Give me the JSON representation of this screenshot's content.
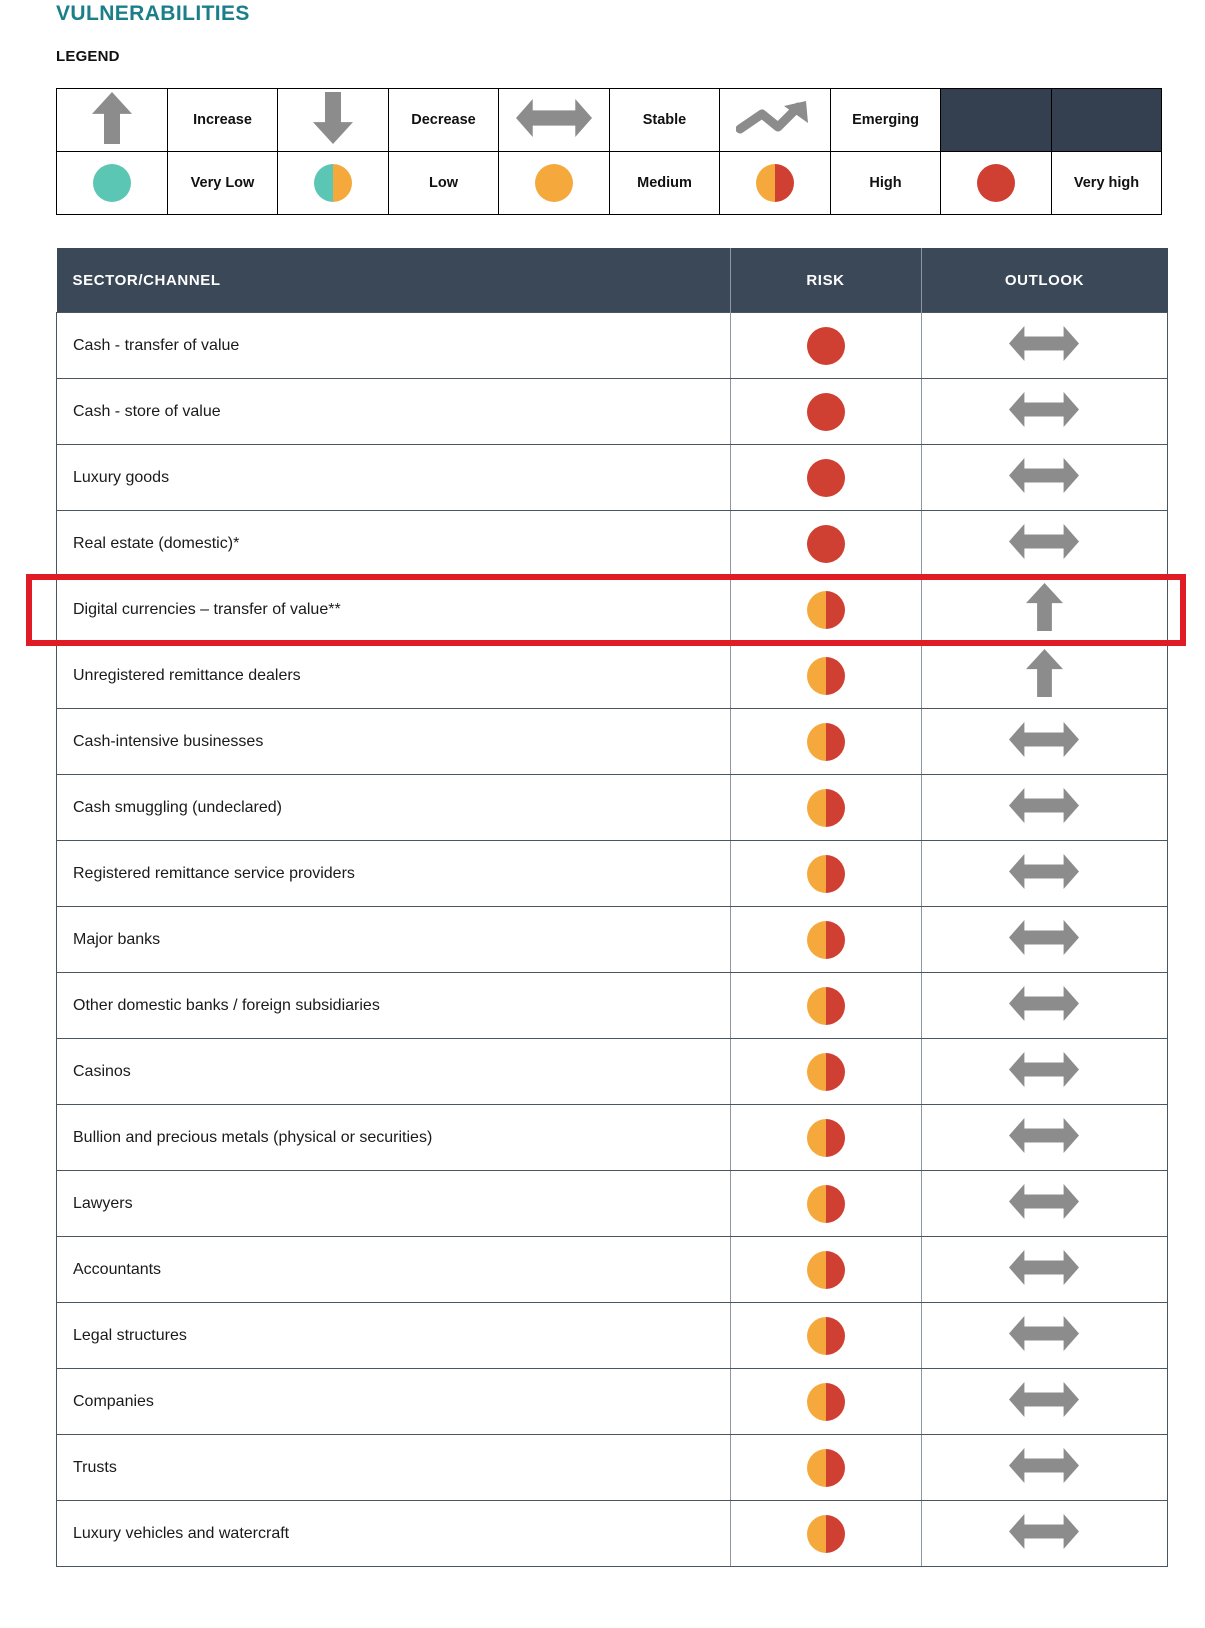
{
  "page_title": "VULNERABILITIES",
  "legend": {
    "title": "LEGEND",
    "row1": [
      {
        "icon": "arrow-up-icon",
        "label": "Increase"
      },
      {
        "icon": "arrow-down-icon",
        "label": "Decrease"
      },
      {
        "icon": "arrow-left-right-icon",
        "label": "Stable"
      },
      {
        "icon": "trend-up-icon",
        "label": "Emerging"
      },
      {
        "icon": "blank",
        "label": ""
      }
    ],
    "row2": [
      {
        "icon": "circle-very-low",
        "label": "Very Low"
      },
      {
        "icon": "circle-low",
        "label": "Low"
      },
      {
        "icon": "circle-medium",
        "label": "Medium"
      },
      {
        "icon": "circle-high",
        "label": "High"
      },
      {
        "icon": "circle-very-high",
        "label": "Very high"
      }
    ]
  },
  "colors": {
    "title_teal": "#1b7f8a",
    "header_dark": "#3a4857",
    "legend_dark_cell": "#343f4f",
    "very_low_teal": "#5cc6b5",
    "medium_orange": "#f5a93c",
    "very_high_red": "#cf3f32",
    "arrow_gray": "#8c8c8c",
    "highlight_red": "#e01b24"
  },
  "table": {
    "headers": {
      "sector": "SECTOR/CHANNEL",
      "risk": "RISK",
      "outlook": "OUTLOOK"
    },
    "highlighted_row_index": 4,
    "rows": [
      {
        "sector": "Cash - transfer of value",
        "risk": "Very high",
        "risk_icon": "circle-very-high",
        "outlook": "Stable",
        "outlook_icon": "arrow-left-right-icon"
      },
      {
        "sector": "Cash - store of value",
        "risk": "Very high",
        "risk_icon": "circle-very-high",
        "outlook": "Stable",
        "outlook_icon": "arrow-left-right-icon"
      },
      {
        "sector": "Luxury goods",
        "risk": "Very high",
        "risk_icon": "circle-very-high",
        "outlook": "Stable",
        "outlook_icon": "arrow-left-right-icon"
      },
      {
        "sector": "Real estate (domestic)*",
        "risk": "Very high",
        "risk_icon": "circle-very-high",
        "outlook": "Stable",
        "outlook_icon": "arrow-left-right-icon"
      },
      {
        "sector": "Digital currencies – transfer of value**",
        "risk": "High",
        "risk_icon": "circle-high",
        "outlook": "Increase",
        "outlook_icon": "arrow-up-icon"
      },
      {
        "sector": "Unregistered remittance dealers",
        "risk": "High",
        "risk_icon": "circle-high",
        "outlook": "Increase",
        "outlook_icon": "arrow-up-icon"
      },
      {
        "sector": "Cash-intensive businesses",
        "risk": "High",
        "risk_icon": "circle-high",
        "outlook": "Stable",
        "outlook_icon": "arrow-left-right-icon"
      },
      {
        "sector": "Cash smuggling (undeclared)",
        "risk": "High",
        "risk_icon": "circle-high",
        "outlook": "Stable",
        "outlook_icon": "arrow-left-right-icon"
      },
      {
        "sector": "Registered remittance service providers",
        "risk": "High",
        "risk_icon": "circle-high",
        "outlook": "Stable",
        "outlook_icon": "arrow-left-right-icon"
      },
      {
        "sector": "Major banks",
        "risk": "High",
        "risk_icon": "circle-high",
        "outlook": "Stable",
        "outlook_icon": "arrow-left-right-icon"
      },
      {
        "sector": "Other domestic banks / foreign subsidiaries",
        "risk": "High",
        "risk_icon": "circle-high",
        "outlook": "Stable",
        "outlook_icon": "arrow-left-right-icon"
      },
      {
        "sector": "Casinos",
        "risk": "High",
        "risk_icon": "circle-high",
        "outlook": "Stable",
        "outlook_icon": "arrow-left-right-icon"
      },
      {
        "sector": "Bullion and precious metals (physical or securities)",
        "risk": "High",
        "risk_icon": "circle-high",
        "outlook": "Stable",
        "outlook_icon": "arrow-left-right-icon"
      },
      {
        "sector": "Lawyers",
        "risk": "High",
        "risk_icon": "circle-high",
        "outlook": "Stable",
        "outlook_icon": "arrow-left-right-icon"
      },
      {
        "sector": "Accountants",
        "risk": "High",
        "risk_icon": "circle-high",
        "outlook": "Stable",
        "outlook_icon": "arrow-left-right-icon"
      },
      {
        "sector": "Legal structures",
        "risk": "High",
        "risk_icon": "circle-high",
        "outlook": "Stable",
        "outlook_icon": "arrow-left-right-icon"
      },
      {
        "sector": "Companies",
        "risk": "High",
        "risk_icon": "circle-high",
        "outlook": "Stable",
        "outlook_icon": "arrow-left-right-icon"
      },
      {
        "sector": "Trusts",
        "risk": "High",
        "risk_icon": "circle-high",
        "outlook": "Stable",
        "outlook_icon": "arrow-left-right-icon"
      },
      {
        "sector": "Luxury vehicles and watercraft",
        "risk": "High",
        "risk_icon": "circle-high",
        "outlook": "Stable",
        "outlook_icon": "arrow-left-right-icon"
      }
    ]
  }
}
